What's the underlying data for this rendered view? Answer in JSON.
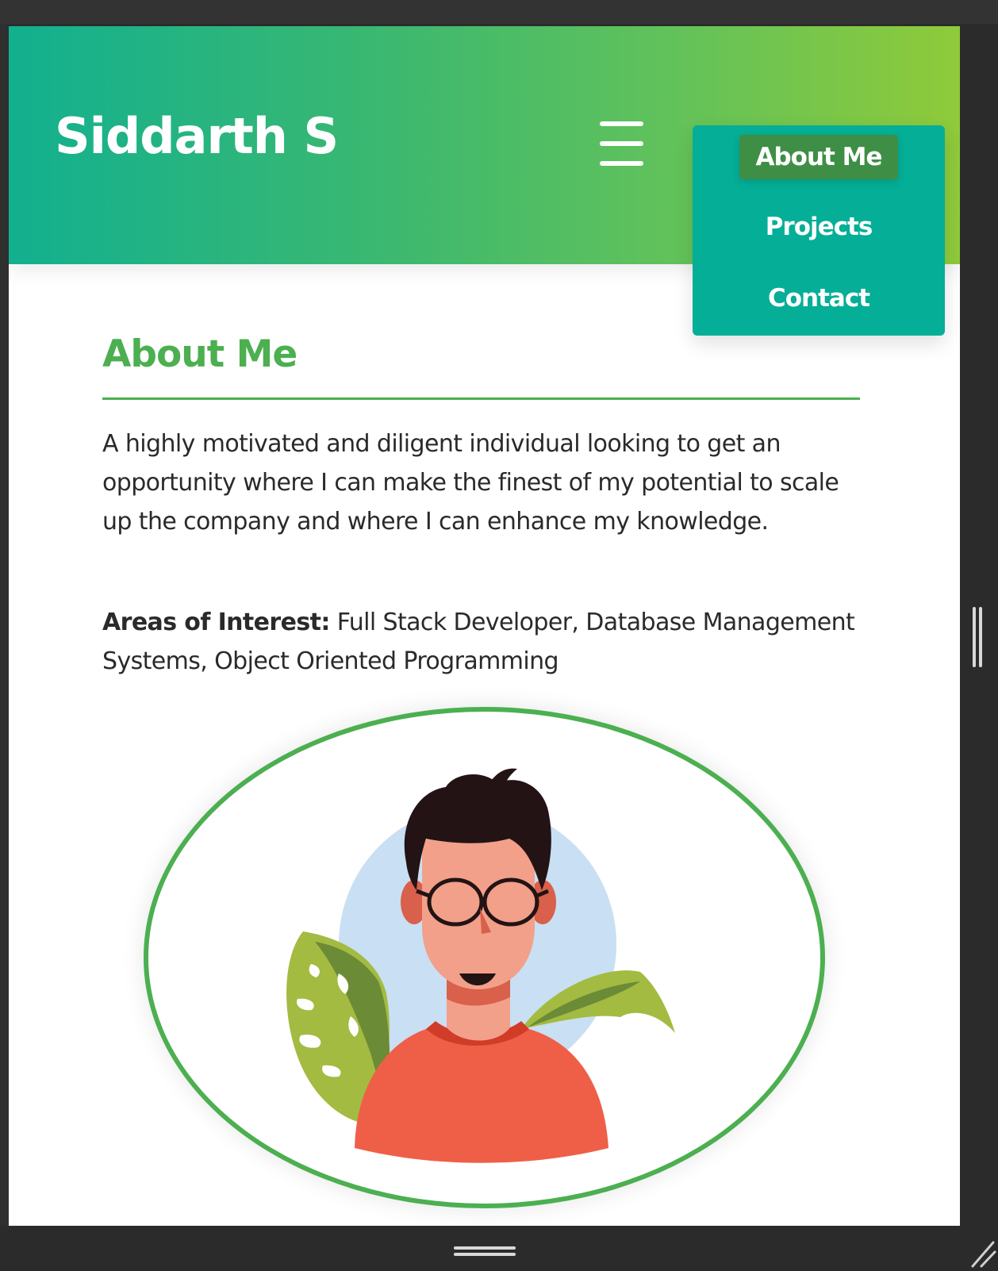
{
  "header": {
    "title": "Siddarth S",
    "menu_icon": "hamburger-menu-icon",
    "gradient_colors": [
      "#12b08f",
      "#8fca3a"
    ]
  },
  "nav": {
    "items": [
      {
        "label": "About Me",
        "active": true
      },
      {
        "label": "Projects",
        "active": false
      },
      {
        "label": "Contact",
        "active": false
      }
    ],
    "background_color": "#05ae97",
    "active_color": "#3e8f45"
  },
  "about": {
    "heading": "About Me",
    "bio": "A highly motivated and diligent individual looking to get an opportunity where I can make the finest of my potential to scale up the company and where I can enhance my knowledge.",
    "interests_label": "Areas of Interest:",
    "interests_text": " Full Stack Developer, Database Management Systems, Object Oriented Programming",
    "accent_color": "#4caf50"
  },
  "avatar": {
    "illustration": "man-with-glasses-avatar-illustration"
  },
  "window": {
    "scroll_handle_icon": "vertical-resize-grip-icon",
    "bottom_handle_icon": "horizontal-resize-grip-icon",
    "corner_icon": "resize-corner-icon"
  }
}
